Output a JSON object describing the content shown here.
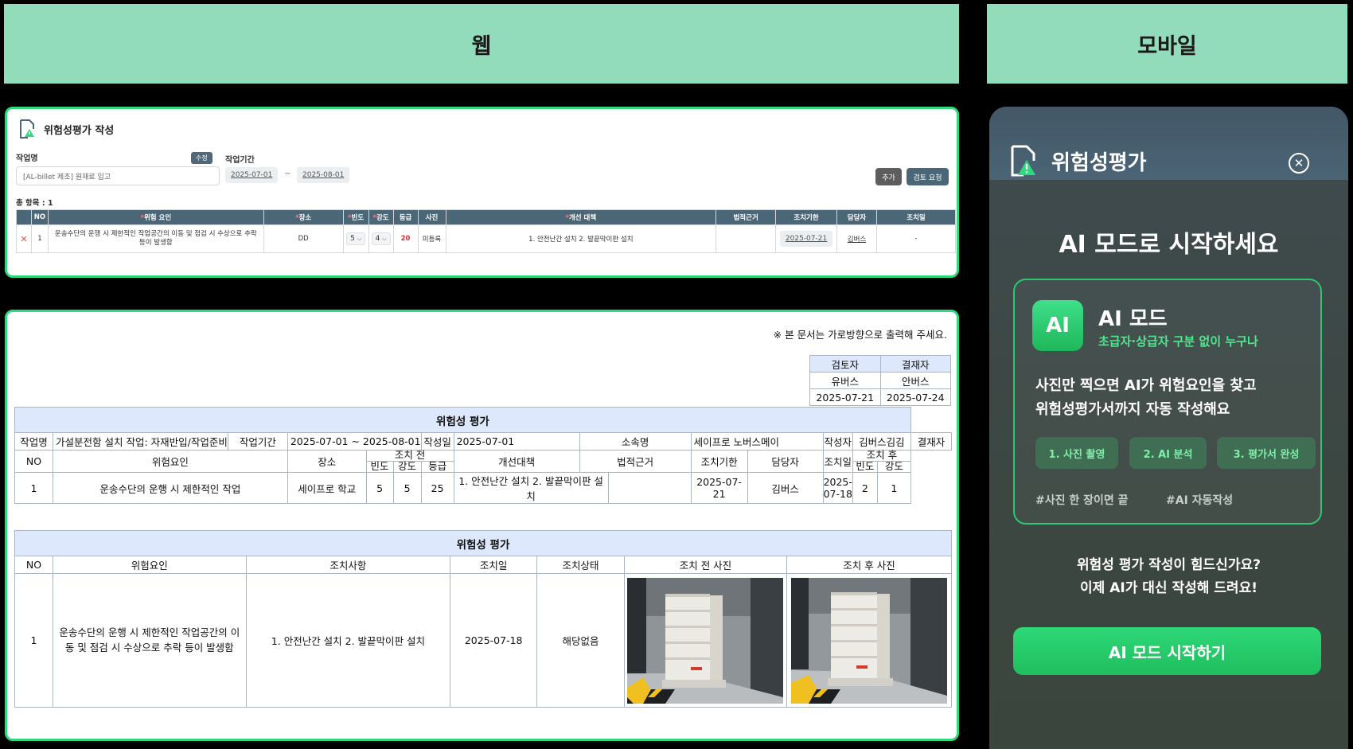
{
  "header": {
    "web": "웹",
    "mobile": "모바일"
  },
  "form": {
    "title": "위험성평가 작성",
    "work_name_label": "작업명",
    "edit_badge": "수정",
    "work_name_value": "[AL-billet 제조] 원재료 입고",
    "period_label": "작업기간",
    "period_start": "2025-07-01",
    "period_sep": "~",
    "period_end": "2025-08-01",
    "add_button": "추가",
    "review_button": "검토 요청",
    "total_label": "총 항목 : 1",
    "columns": [
      "",
      "NO",
      "위험 요인",
      "장소",
      "빈도",
      "강도",
      "등급",
      "사진",
      "개선 대책",
      "법적근거",
      "조치기한",
      "담당자",
      "조치일"
    ],
    "required_mark": "*",
    "row": {
      "delete": "✕",
      "no": "1",
      "risk": "운송수단의 운행 시 제한적인 작업공간의 이동 및 점검 시 수상으로 추락 등이 발생함",
      "place": "DD",
      "freq": "5",
      "sev": "4",
      "grade": "20",
      "photo": "미등록",
      "measure": "1. 안전난간 설치 2. 발끝막이판 설치",
      "legal": "",
      "deadline": "2025-07-21",
      "manager": "김버스",
      "action_date": "-"
    }
  },
  "doc": {
    "print_note": "※ 본 문서는 가로방향으로 출력해 주세요.",
    "approval": {
      "headers": [
        "검토자",
        "결재자"
      ],
      "names": [
        "유버스",
        "안버스"
      ],
      "dates": [
        "2025-07-21",
        "2025-07-24"
      ]
    },
    "table1": {
      "title": "위험성 평가",
      "meta": [
        "작업명",
        "가설분전함 설치 작업: 자재반입/작업준비",
        "작업기간",
        "2025-07-01 ~ 2025-08-01",
        "작성일",
        "2025-07-01",
        "소속명",
        "세이프로 노버스메이",
        "작성자",
        "김버스김김",
        "결재자",
        "김버스김김"
      ],
      "col_no": "NO",
      "col_risk": "위험요인",
      "col_place": "장소",
      "col_before": "조치 전",
      "col_measure": "개선대책",
      "col_legal": "법적근거",
      "col_deadline": "조치기한",
      "col_manager": "담당자",
      "col_action_date": "조치일",
      "col_after": "조치 후",
      "sub": [
        "빈도",
        "강도",
        "등급"
      ],
      "row": [
        "1",
        "운송수단의 운행 시 제한적인 작업",
        "세이프로 학교",
        "5",
        "5",
        "25",
        "1. 안전난간 설치 2. 발끝막이판 설치",
        "",
        "2025-07-21",
        "김버스",
        "2025-07-18",
        "2",
        "1",
        "2"
      ]
    },
    "table2": {
      "title": "위험성 평가",
      "headers": [
        "NO",
        "위험요인",
        "조치사항",
        "조치일",
        "조치상태",
        "조치 전 사진",
        "조치 후 사진"
      ],
      "row": {
        "no": "1",
        "risk": "운송수단의 운행 시 제한적인 작업공간의 이동 및 점검 시 수상으로 추락 등이 발생함",
        "measure": "1. 안전난간 설치 2. 발끝막이판 설치",
        "date": "2025-07-18",
        "status": "해당없음"
      }
    }
  },
  "mobile": {
    "title": "위험성평가",
    "headline": "AI 모드로 시작하세요",
    "card": {
      "badge": "AI",
      "title": "AI 모드",
      "subtitle": "초급자·상급자 구분 없이 누구나",
      "desc1": "사진만 찍으면 AI가 위험요인을 찾고",
      "desc2": "위험성평가서까지 자동 작성해요",
      "steps": [
        "1. 사진 촬영",
        "2. AI 분석",
        "3. 평가서 완성"
      ],
      "tags": [
        "#사진 한 장이면 끝",
        "#AI 자동작성"
      ]
    },
    "question1": "위험성 평가 작성이 힘드신가요?",
    "question2": "이제 AI가 대신 작성해 드려요!",
    "cta": "AI 모드 시작하기"
  },
  "colors": {
    "accent_green": "#2fd97e",
    "header_mint": "#92dcbb",
    "table_head": "#4b6676",
    "doc_head": "#dde8fc"
  }
}
